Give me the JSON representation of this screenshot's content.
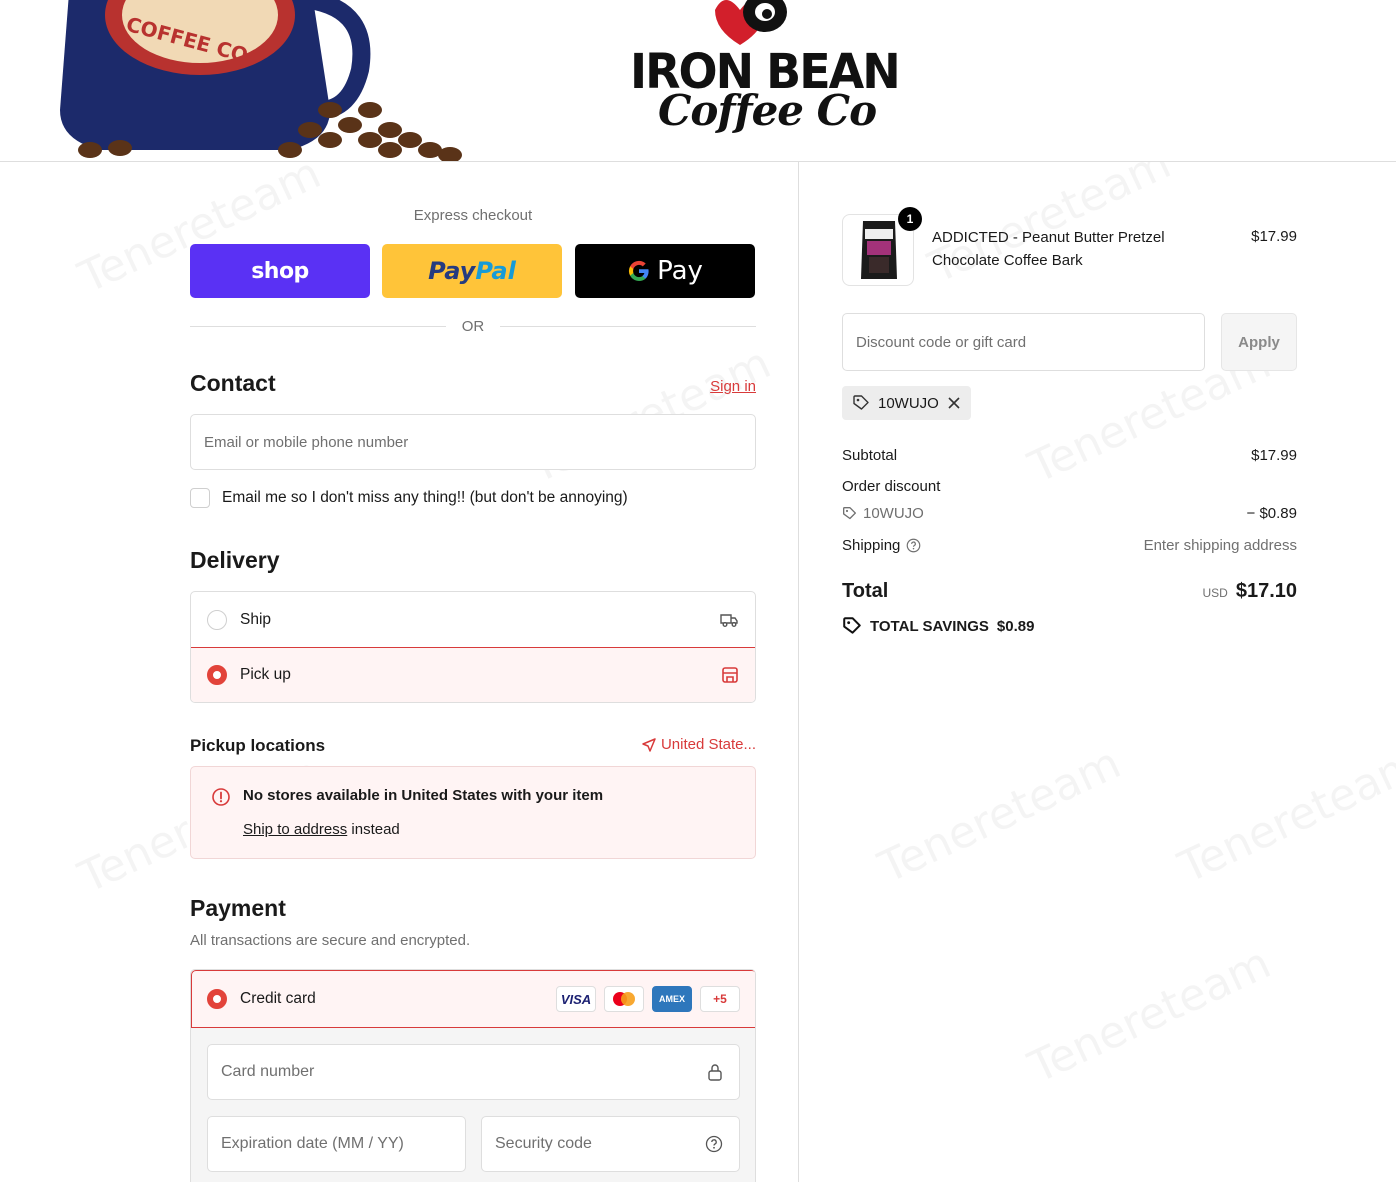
{
  "brand": {
    "logo_line1": "IRON BEAN",
    "logo_line2": "Coffee Co",
    "mug_text": "COFFEE CO"
  },
  "express": {
    "title": "Express checkout",
    "shop_label": "shop",
    "paypal_label_1": "Pay",
    "paypal_label_2": "Pal",
    "gpay_label": "Pay",
    "or_label": "OR"
  },
  "contact": {
    "title": "Contact",
    "sign_in": "Sign in",
    "email_placeholder": "Email or mobile phone number",
    "newsletter_label": "Email me so I don't miss any thing!! (but don't be annoying)"
  },
  "delivery": {
    "title": "Delivery",
    "options": [
      {
        "label": "Ship",
        "selected": false
      },
      {
        "label": "Pick up",
        "selected": true
      }
    ]
  },
  "pickup": {
    "title": "Pickup locations",
    "country": "United State...",
    "notice_title": "No stores available in United States with your item",
    "notice_link": "Ship to address",
    "notice_suffix": " instead"
  },
  "payment": {
    "title": "Payment",
    "subtitle": "All transactions are secure and encrypted.",
    "method_label": "Credit card",
    "card_brands": [
      "VISA",
      "",
      "AMEX",
      "+5"
    ],
    "card_number_placeholder": "Card number",
    "expiry_placeholder": "Expiration date (MM / YY)",
    "security_placeholder": "Security code"
  },
  "summary": {
    "item": {
      "quantity": "1",
      "name": "ADDICTED - Peanut Butter Pretzel Chocolate Coffee Bark",
      "price": "$17.99"
    },
    "discount_placeholder": "Discount code or gift card",
    "apply_label": "Apply",
    "applied_code": "10WUJO",
    "subtotal_label": "Subtotal",
    "subtotal_value": "$17.99",
    "order_discount_label": "Order discount",
    "discount_code": "10WUJO",
    "discount_value": "− $0.89",
    "shipping_label": "Shipping",
    "shipping_value": "Enter shipping address",
    "total_label": "Total",
    "currency": "USD",
    "total_value": "$17.10",
    "savings_label": "TOTAL SAVINGS",
    "savings_value": "$0.89"
  },
  "colors": {
    "accent": "#d83a3a",
    "shop_purple": "#5a31f4",
    "paypal_yellow": "#ffc439",
    "selected_bg": "#fff4f4"
  },
  "watermark": "Tenereteam"
}
